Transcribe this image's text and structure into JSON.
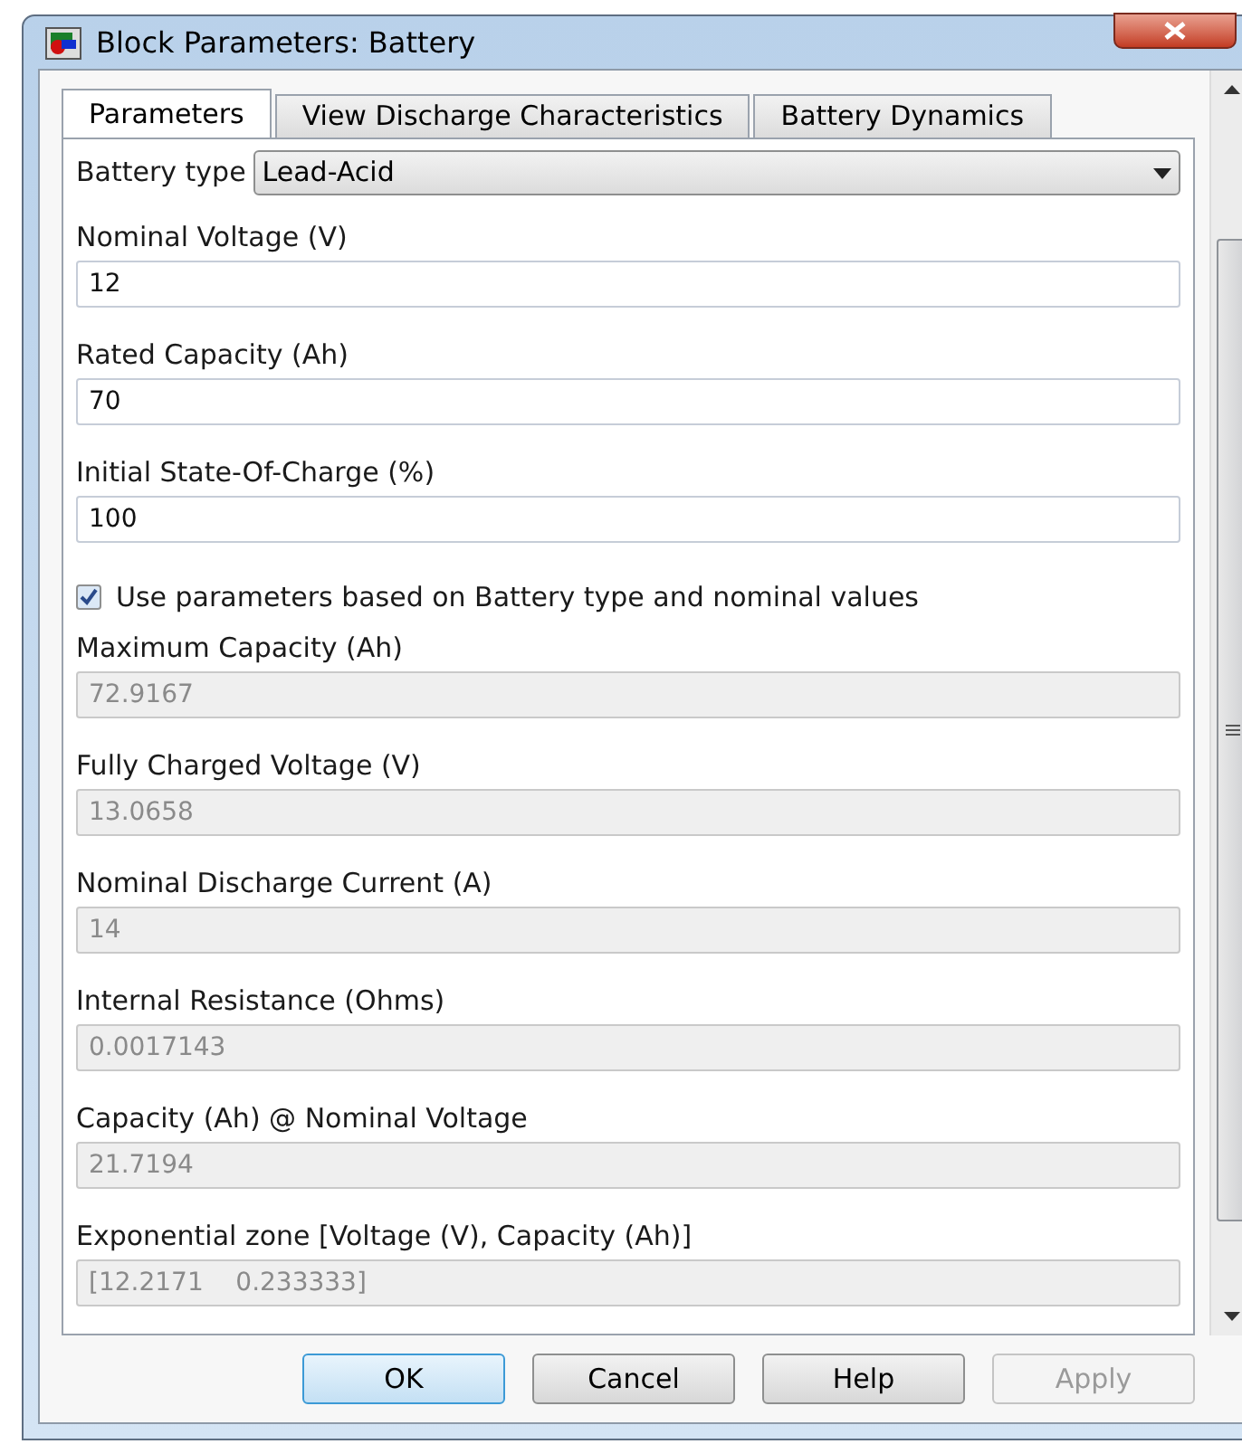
{
  "window": {
    "title": "Block Parameters: Battery"
  },
  "tabs": [
    {
      "label": "Parameters",
      "selected": true
    },
    {
      "label": "View Discharge Characteristics",
      "selected": false
    },
    {
      "label": "Battery Dynamics",
      "selected": false
    }
  ],
  "battery_type": {
    "label": "Battery type",
    "value": "Lead-Acid"
  },
  "fields": [
    {
      "kind": "field",
      "label": "Nominal Voltage (V)",
      "value": "12",
      "disabled": false
    },
    {
      "kind": "field",
      "label": "Rated Capacity (Ah)",
      "value": "70",
      "disabled": false
    },
    {
      "kind": "field",
      "label": "Initial State-Of-Charge (%)",
      "value": "100",
      "disabled": false
    },
    {
      "kind": "checkbox",
      "label": "Use parameters based on Battery type and nominal values",
      "checked": true
    },
    {
      "kind": "field",
      "label": "Maximum Capacity (Ah)",
      "value": "72.9167",
      "disabled": true
    },
    {
      "kind": "field",
      "label": "Fully Charged Voltage (V)",
      "value": "13.0658",
      "disabled": true
    },
    {
      "kind": "field",
      "label": "Nominal Discharge Current (A)",
      "value": "14",
      "disabled": true
    },
    {
      "kind": "field",
      "label": "Internal Resistance (Ohms)",
      "value": "0.0017143",
      "disabled": true
    },
    {
      "kind": "field",
      "label": "Capacity (Ah) @ Nominal Voltage",
      "value": "21.7194",
      "disabled": true
    },
    {
      "kind": "field",
      "label": "Exponential zone [Voltage (V), Capacity (Ah)]",
      "value": "[12.2171    0.233333]",
      "disabled": true
    }
  ],
  "buttons": [
    {
      "label": "OK",
      "disabled": false,
      "selected": true
    },
    {
      "label": "Cancel",
      "disabled": false,
      "selected": false
    },
    {
      "label": "Help",
      "disabled": false,
      "selected": false
    },
    {
      "label": "Apply",
      "disabled": true,
      "selected": false
    }
  ]
}
